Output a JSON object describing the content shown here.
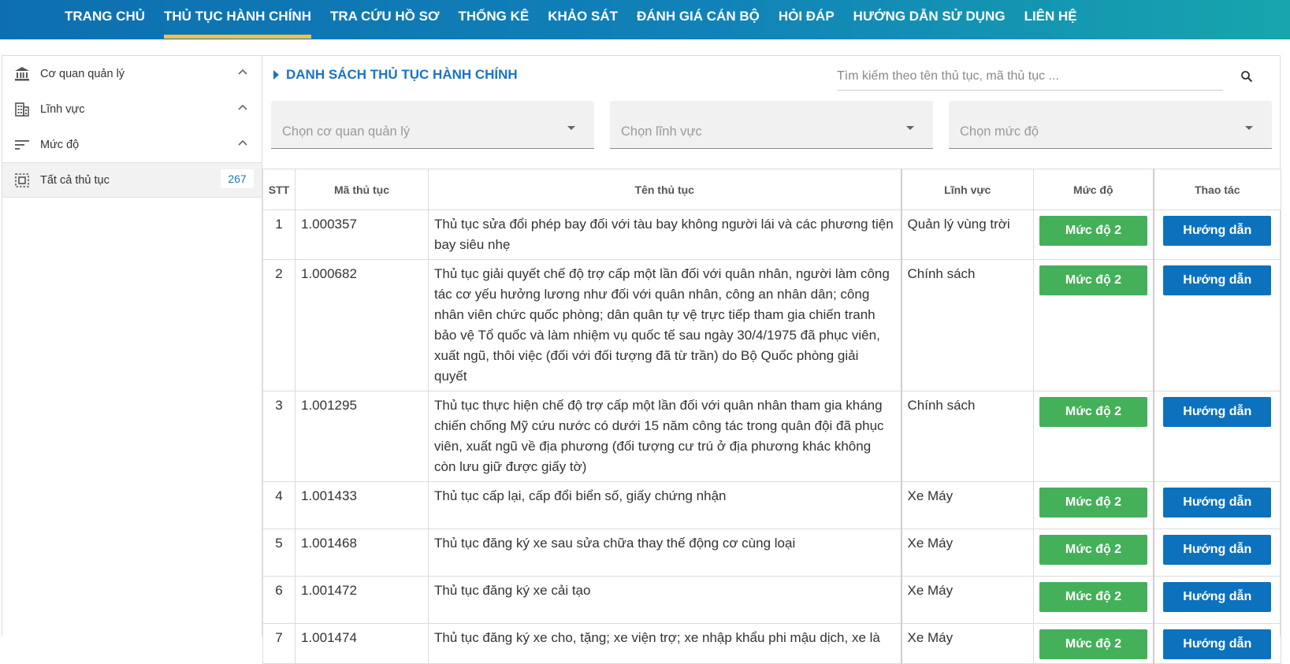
{
  "nav": {
    "items": [
      "TRANG CHỦ",
      "THỦ TỤC HÀNH CHÍNH",
      "TRA CỨU HỒ SƠ",
      "THỐNG KÊ",
      "KHẢO SÁT",
      "ĐÁNH GIÁ CÁN BỘ",
      "HỎI ĐÁP",
      "HƯỚNG DẪN SỬ DỤNG",
      "LIÊN HỆ"
    ],
    "active_index": 1,
    "active_underline_color": "#f2c14b"
  },
  "sidebar": {
    "items": [
      {
        "label": "Cơ quan quản lý",
        "icon": "bank-icon"
      },
      {
        "label": "Lĩnh vực",
        "icon": "building-icon"
      },
      {
        "label": "Mức độ",
        "icon": "sort-lines-icon"
      }
    ],
    "all": {
      "label": "Tất cả thủ tục",
      "count": "267",
      "icon": "select-all-icon"
    }
  },
  "main": {
    "title": "DANH SÁCH THỦ TỤC HÀNH CHÍNH",
    "search_placeholder": "Tìm kiếm theo tên thủ tục, mã thủ tục ...",
    "filters": [
      "Chọn cơ quan quản lý",
      "Chọn lĩnh vực",
      "Chọn mức độ"
    ]
  },
  "table": {
    "headers": {
      "stt": "STT",
      "code": "Mã thủ tục",
      "name": "Tên thủ tục",
      "field": "Lĩnh vực",
      "level": "Mức độ",
      "action": "Thao tác"
    },
    "rows": [
      {
        "stt": "1",
        "code": "1.000357",
        "name": "Thủ tục sửa đổi phép bay đối với tàu bay không người lái và các phương tiện bay siêu nhẹ",
        "field": "Quản lý vùng trời",
        "level": "Mức độ 2",
        "action": "Hướng dẫn"
      },
      {
        "stt": "2",
        "code": "1.000682",
        "name": "Thủ tục giải quyết chế độ trợ cấp một lần đối với quân nhân, người làm công tác cơ yếu hưởng lương như đối với quân nhân, công an nhân dân; công nhân viên chức quốc phòng; dân quân tự vệ trực tiếp tham gia chiến tranh bảo vệ Tổ quốc và làm nhiệm vụ quốc tế sau ngày 30/4/1975 đã phục viên, xuất ngũ, thôi việc (đối với đối tượng đã từ trần) do Bộ Quốc phòng giải quyết",
        "field": "Chính sách",
        "level": "Mức độ 2",
        "action": "Hướng dẫn"
      },
      {
        "stt": "3",
        "code": "1.001295",
        "name": "Thủ tục thực hiện chế độ trợ cấp một lần đối với quân nhân tham gia kháng chiến chống Mỹ cứu nước có dưới 15 năm công tác trong quân đội đã phục viên, xuất ngũ về địa phương (đối tượng cư trú ở địa phương khác không còn lưu giữ được giấy tờ)",
        "field": "Chính sách",
        "level": "Mức độ 2",
        "action": "Hướng dẫn"
      },
      {
        "stt": "4",
        "code": "1.001433",
        "name": "Thủ tục cấp lại, cấp đổi biển số, giấy chứng nhận",
        "field": "Xe Máy",
        "level": "Mức độ 2",
        "action": "Hướng dẫn"
      },
      {
        "stt": "5",
        "code": "1.001468",
        "name": "Thủ tục đăng ký xe sau sửa chữa thay thế động cơ cùng loại",
        "field": "Xe Máy",
        "level": "Mức độ 2",
        "action": "Hướng dẫn"
      },
      {
        "stt": "6",
        "code": "1.001472",
        "name": "Thủ tục đăng ký xe cải tạo",
        "field": "Xe Máy",
        "level": "Mức độ 2",
        "action": "Hướng dẫn"
      },
      {
        "stt": "7",
        "code": "1.001474",
        "name": "Thủ tục đăng ký xe cho, tặng; xe viện trợ; xe nhập khẩu phi mậu dịch, xe là",
        "field": "Xe Máy",
        "level": "Mức độ 2",
        "action": "Hướng dẫn"
      }
    ]
  },
  "colors": {
    "level_button": "#45b05a",
    "action_button": "#0d72bd",
    "title": "#1a73c4"
  }
}
